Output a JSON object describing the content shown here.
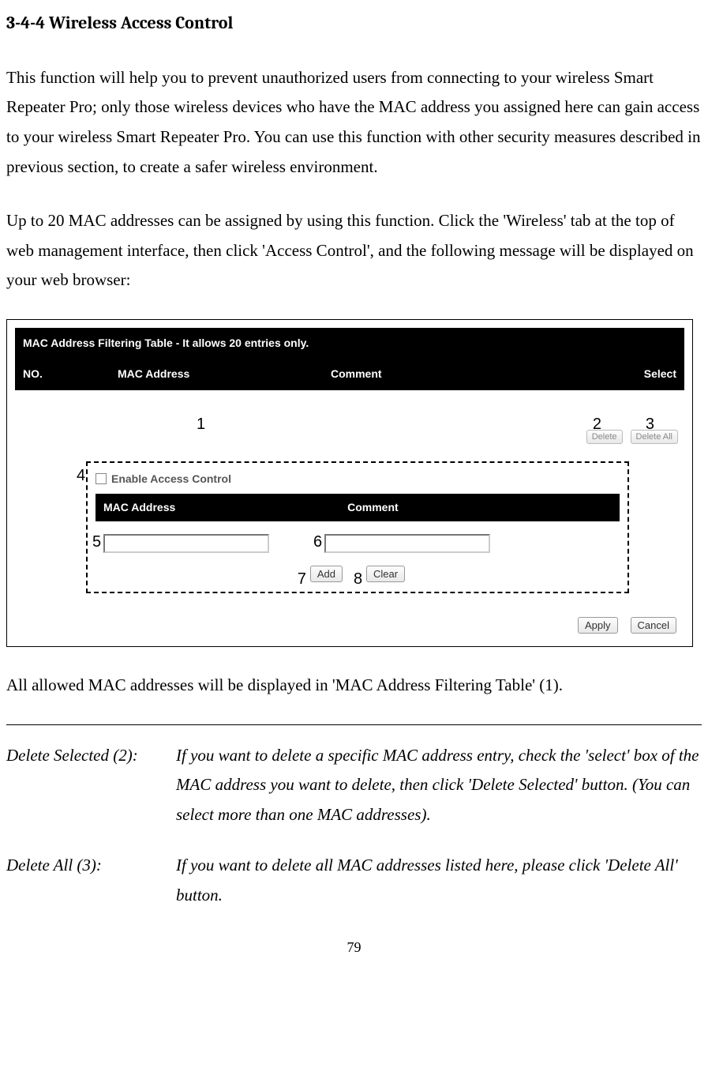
{
  "heading": "3-4-4 Wireless Access Control",
  "para1": "This function will help you to prevent unauthorized users from connecting to your wireless Smart Repeater Pro; only those wireless devices who have the MAC address you assigned here can gain access to your wireless Smart Repeater Pro. You can use this function with other security measures described in previous section, to create a safer wireless environment.",
  "para2": "Up to 20 MAC addresses can be assigned by using this function. Click the 'Wireless' tab at the top of web management interface, then click 'Access Control', and the following message will be displayed on your web browser:",
  "screenshot": {
    "tableTitle": "MAC Address Filtering Table - It allows 20 entries only.",
    "headers": {
      "no": "NO.",
      "mac": "MAC Address",
      "comment": "Comment",
      "select": "Select"
    },
    "deleteBtn": "Delete",
    "deleteAllBtn": "Delete All",
    "enableLabel": "Enable Access Control",
    "innerHeaders": {
      "mac": "MAC Address",
      "comment": "Comment"
    },
    "addBtn": "Add",
    "clearBtn": "Clear",
    "applyBtn": "Apply",
    "cancelBtn": "Cancel",
    "annotations": {
      "n1": "1",
      "n2": "2",
      "n3": "3",
      "n4": "4",
      "n5": "5",
      "n6": "6",
      "n7": "7",
      "n8": "8"
    }
  },
  "para3": "All allowed MAC addresses will be displayed in 'MAC Address Filtering Table' (1).",
  "defs": {
    "d2": {
      "term": "Delete Selected (2):",
      "desc": "If you want to delete a specific MAC address entry, check the 'select' box of the MAC address you want to delete, then click 'Delete Selected' button. (You can select more than one MAC addresses)."
    },
    "d3": {
      "term": "Delete All (3):",
      "desc": "If you want to delete all MAC addresses listed here, please click 'Delete All' button."
    }
  },
  "pageNumber": "79"
}
